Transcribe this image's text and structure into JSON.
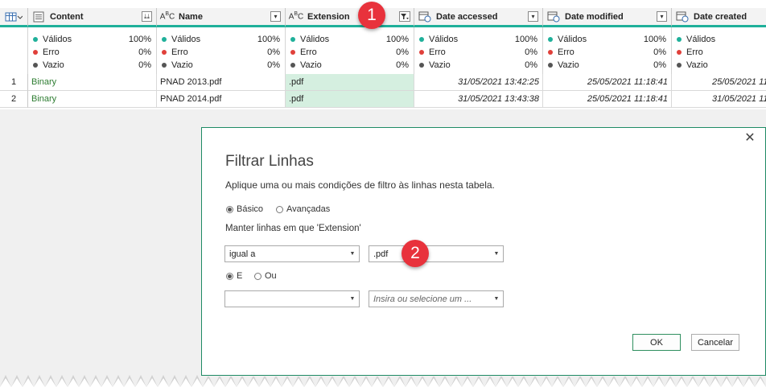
{
  "columns": [
    {
      "name": "Content",
      "type_icon": "list-icon"
    },
    {
      "name": "Name",
      "type_icon": "abc-icon"
    },
    {
      "name": "Extension",
      "type_icon": "abc-icon"
    },
    {
      "name": "Date accessed",
      "type_icon": "calendar-clock-icon"
    },
    {
      "name": "Date modified",
      "type_icon": "calendar-clock-icon"
    },
    {
      "name": "Date created",
      "type_icon": "calendar-clock-icon"
    }
  ],
  "profile": {
    "valid_label": "Válidos",
    "error_label": "Erro",
    "empty_label": "Vazio",
    "valid_pct": "100%",
    "error_pct": "0%",
    "empty_pct": "0%",
    "colors": {
      "valid": "#1fb09a",
      "error": "#e0403a",
      "empty": "#555555"
    }
  },
  "rows": [
    {
      "num": "1",
      "content": "Binary",
      "name": "PNAD 2013.pdf",
      "ext": ".pdf",
      "accessed": "31/05/2021 13:42:25",
      "modified": "25/05/2021 11:18:41",
      "created": "25/05/2021 11:"
    },
    {
      "num": "2",
      "content": "Binary",
      "name": "PNAD 2014.pdf",
      "ext": ".pdf",
      "accessed": "31/05/2021 13:43:38",
      "modified": "25/05/2021 11:18:41",
      "created": "31/05/2021 11:"
    }
  ],
  "badges": {
    "one": "1",
    "two": "2"
  },
  "dialog": {
    "title": "Filtrar Linhas",
    "subtitle": "Aplique uma ou mais condições de filtro às linhas nesta tabela.",
    "mode_basic": "Básico",
    "mode_advanced": "Avançadas",
    "keep_rows": "Manter linhas em que 'Extension'",
    "operator1": "igual a",
    "value1": ".pdf",
    "and_label": "E",
    "or_label": "Ou",
    "operator2": "",
    "value2_placeholder": "Insira ou selecione um ...",
    "ok": "OK",
    "cancel": "Cancelar",
    "accent": "#1e8a64"
  }
}
